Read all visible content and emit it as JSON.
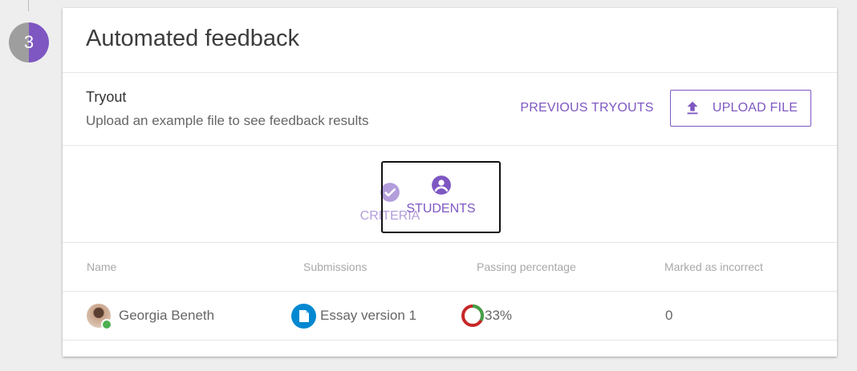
{
  "step": {
    "number": "3"
  },
  "card": {
    "title": "Automated feedback"
  },
  "tryout": {
    "title": "Tryout",
    "subtitle": "Upload an example file to see feedback results",
    "previous_label": "PREVIOUS TRYOUTS",
    "upload_label": "UPLOAD FILE"
  },
  "tabs": [
    {
      "label": "CRITERIA",
      "icon": "check-circle-icon",
      "active": false
    },
    {
      "label": "STUDENTS",
      "icon": "account-circle-icon",
      "active": true
    }
  ],
  "table": {
    "headers": [
      "Name",
      "Submissions",
      "Passing percentage",
      "Marked as incorrect"
    ],
    "rows": [
      {
        "name": "Georgia Beneth",
        "submission": "Essay version 1",
        "passing_percentage": "33%",
        "passing_fraction": 0.33,
        "marked_incorrect": "0"
      }
    ]
  },
  "colors": {
    "accent": "#7e57c2",
    "accent_light": "#b39ddb",
    "pass": "#43a047",
    "fail": "#c62828",
    "online": "#4caf50",
    "doc": "#0288d1"
  }
}
